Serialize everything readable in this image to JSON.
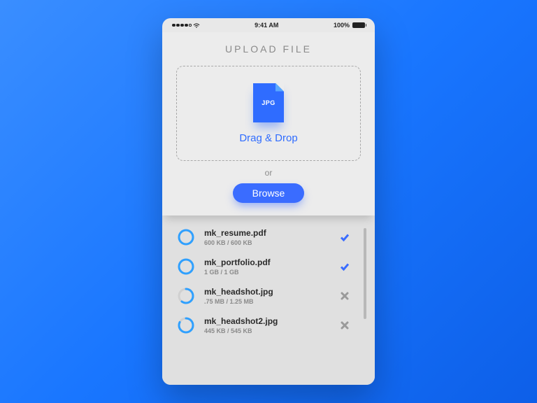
{
  "status": {
    "time": "9:41 AM",
    "battery": "100%"
  },
  "page": {
    "title": "UPLOAD FILE",
    "dropzone": {
      "file_type": "JPG",
      "text": "Drag & Drop"
    },
    "or_text": "or",
    "browse_label": "Browse"
  },
  "files": [
    {
      "name": "mk_resume.pdf",
      "meta": "600 KB / 600 KB",
      "progress": 100,
      "status": "done"
    },
    {
      "name": "mk_portfolio.pdf",
      "meta": "1 GB / 1 GB",
      "progress": 100,
      "status": "done"
    },
    {
      "name": "mk_headshot.jpg",
      "meta": ".75 MB / 1.25 MB",
      "progress": 60,
      "status": "cancel"
    },
    {
      "name": "mk_headshot2.jpg",
      "meta": "445 KB / 545 KB",
      "progress": 82,
      "status": "cancel"
    }
  ],
  "colors": {
    "primary": "#3a6cff",
    "muted": "#8a8a8a"
  }
}
